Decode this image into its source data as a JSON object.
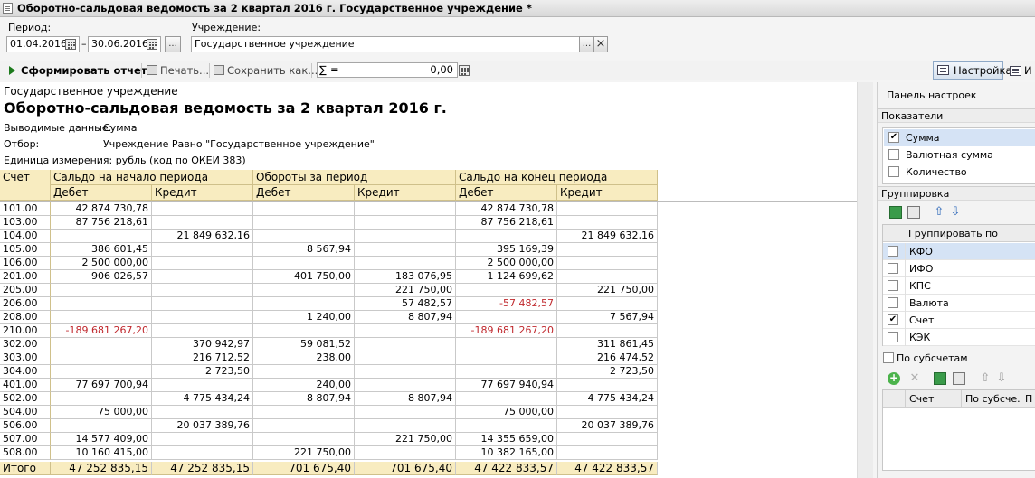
{
  "window": {
    "title": "Оборотно-сальдовая ведомость за 2 квартал 2016 г. Государственное учреждение *"
  },
  "form": {
    "period_label": "Период:",
    "date_from": "01.04.2016",
    "date_sep": "–",
    "date_to": "30.06.2016",
    "period_btn": "...",
    "institution_label": "Учреждение:",
    "institution_value": "Государственное учреждение",
    "institution_select": "...",
    "institution_clear": "×"
  },
  "toolbar": {
    "generate": "Сформировать отчет",
    "print": "Печать...",
    "save": "Сохранить как...",
    "sum_sign": "∑",
    "sum_eq": "=",
    "sum_value": "0,00",
    "settings": "Настройка",
    "extra": "И"
  },
  "report": {
    "org": "Государственное учреждение",
    "title": "Оборотно-сальдовая ведомость за 2 квартал 2016 г.",
    "meta": [
      {
        "label": "Выводимые данные:",
        "value": "Сумма"
      },
      {
        "label": "Отбор:",
        "value": "Учреждение Равно \"Государственное учреждение\""
      }
    ],
    "units": "Единица измерения: рубль (код по ОКЕИ 383)",
    "headers": {
      "account": "Счет",
      "opening": "Сальдо на начало периода",
      "turnover": "Обороты за период",
      "closing": "Сальдо на конец периода",
      "debit": "Дебет",
      "credit": "Кредит"
    },
    "rows": [
      [
        "101.00",
        "42 874 730,78",
        "",
        "",
        "",
        "42 874 730,78",
        ""
      ],
      [
        "103.00",
        "87 756 218,61",
        "",
        "",
        "",
        "87 756 218,61",
        ""
      ],
      [
        "104.00",
        "",
        "21 849 632,16",
        "",
        "",
        "",
        "21 849 632,16"
      ],
      [
        "105.00",
        "386 601,45",
        "",
        "8 567,94",
        "",
        "395 169,39",
        ""
      ],
      [
        "106.00",
        "2 500 000,00",
        "",
        "",
        "",
        "2 500 000,00",
        ""
      ],
      [
        "201.00",
        "906 026,57",
        "",
        "401 750,00",
        "183 076,95",
        "1 124 699,62",
        ""
      ],
      [
        "205.00",
        "",
        "",
        "",
        "221 750,00",
        "",
        "221 750,00"
      ],
      [
        "206.00",
        "",
        "",
        "",
        "57 482,57",
        "-57 482,57",
        ""
      ],
      [
        "208.00",
        "",
        "",
        "1 240,00",
        "8 807,94",
        "",
        "7 567,94"
      ],
      [
        "210.00",
        "-189 681 267,20",
        "",
        "",
        "",
        "-189 681 267,20",
        ""
      ],
      [
        "302.00",
        "",
        "370 942,97",
        "59 081,52",
        "",
        "",
        "311 861,45"
      ],
      [
        "303.00",
        "",
        "216 712,52",
        "238,00",
        "",
        "",
        "216 474,52"
      ],
      [
        "304.00",
        "",
        "2 723,50",
        "",
        "",
        "",
        "2 723,50"
      ],
      [
        "401.00",
        "77 697 700,94",
        "",
        "240,00",
        "",
        "77 697 940,94",
        ""
      ],
      [
        "502.00",
        "",
        "4 775 434,24",
        "8 807,94",
        "8 807,94",
        "",
        "4 775 434,24"
      ],
      [
        "504.00",
        "75 000,00",
        "",
        "",
        "",
        "75 000,00",
        ""
      ],
      [
        "506.00",
        "",
        "20 037 389,76",
        "",
        "",
        "",
        "20 037 389,76"
      ],
      [
        "507.00",
        "14 577 409,00",
        "",
        "",
        "221 750,00",
        "14 355 659,00",
        ""
      ],
      [
        "508.00",
        "10 160 415,00",
        "",
        "221 750,00",
        "",
        "10 382 165,00",
        ""
      ]
    ],
    "total": [
      "Итого",
      "47 252 835,15",
      "47 252 835,15",
      "701 675,40",
      "701 675,40",
      "47 422 833,57",
      "47 422 833,57"
    ]
  },
  "panel": {
    "title": "Панель настроек",
    "indicators_label": "Показатели",
    "indicators": [
      {
        "label": "Сумма",
        "checked": true
      },
      {
        "label": "Валютная сумма",
        "checked": false
      },
      {
        "label": "Количество",
        "checked": false
      }
    ],
    "grouping_label": "Группировка",
    "group_header": "Группировать по",
    "groups": [
      {
        "label": "КФО",
        "checked": false
      },
      {
        "label": "ИФО",
        "checked": false
      },
      {
        "label": "КПС",
        "checked": false
      },
      {
        "label": "Валюта",
        "checked": false
      },
      {
        "label": "Счет",
        "checked": true
      },
      {
        "label": "КЭК",
        "checked": false
      }
    ],
    "subaccounts_label": "По субсчетам",
    "sub_headers": [
      "Счет",
      "По субсче...",
      "П"
    ]
  },
  "colors": {
    "header_bg": "#f8ecc0",
    "negative": "#c0282d",
    "selection": "#d5e3f5"
  }
}
